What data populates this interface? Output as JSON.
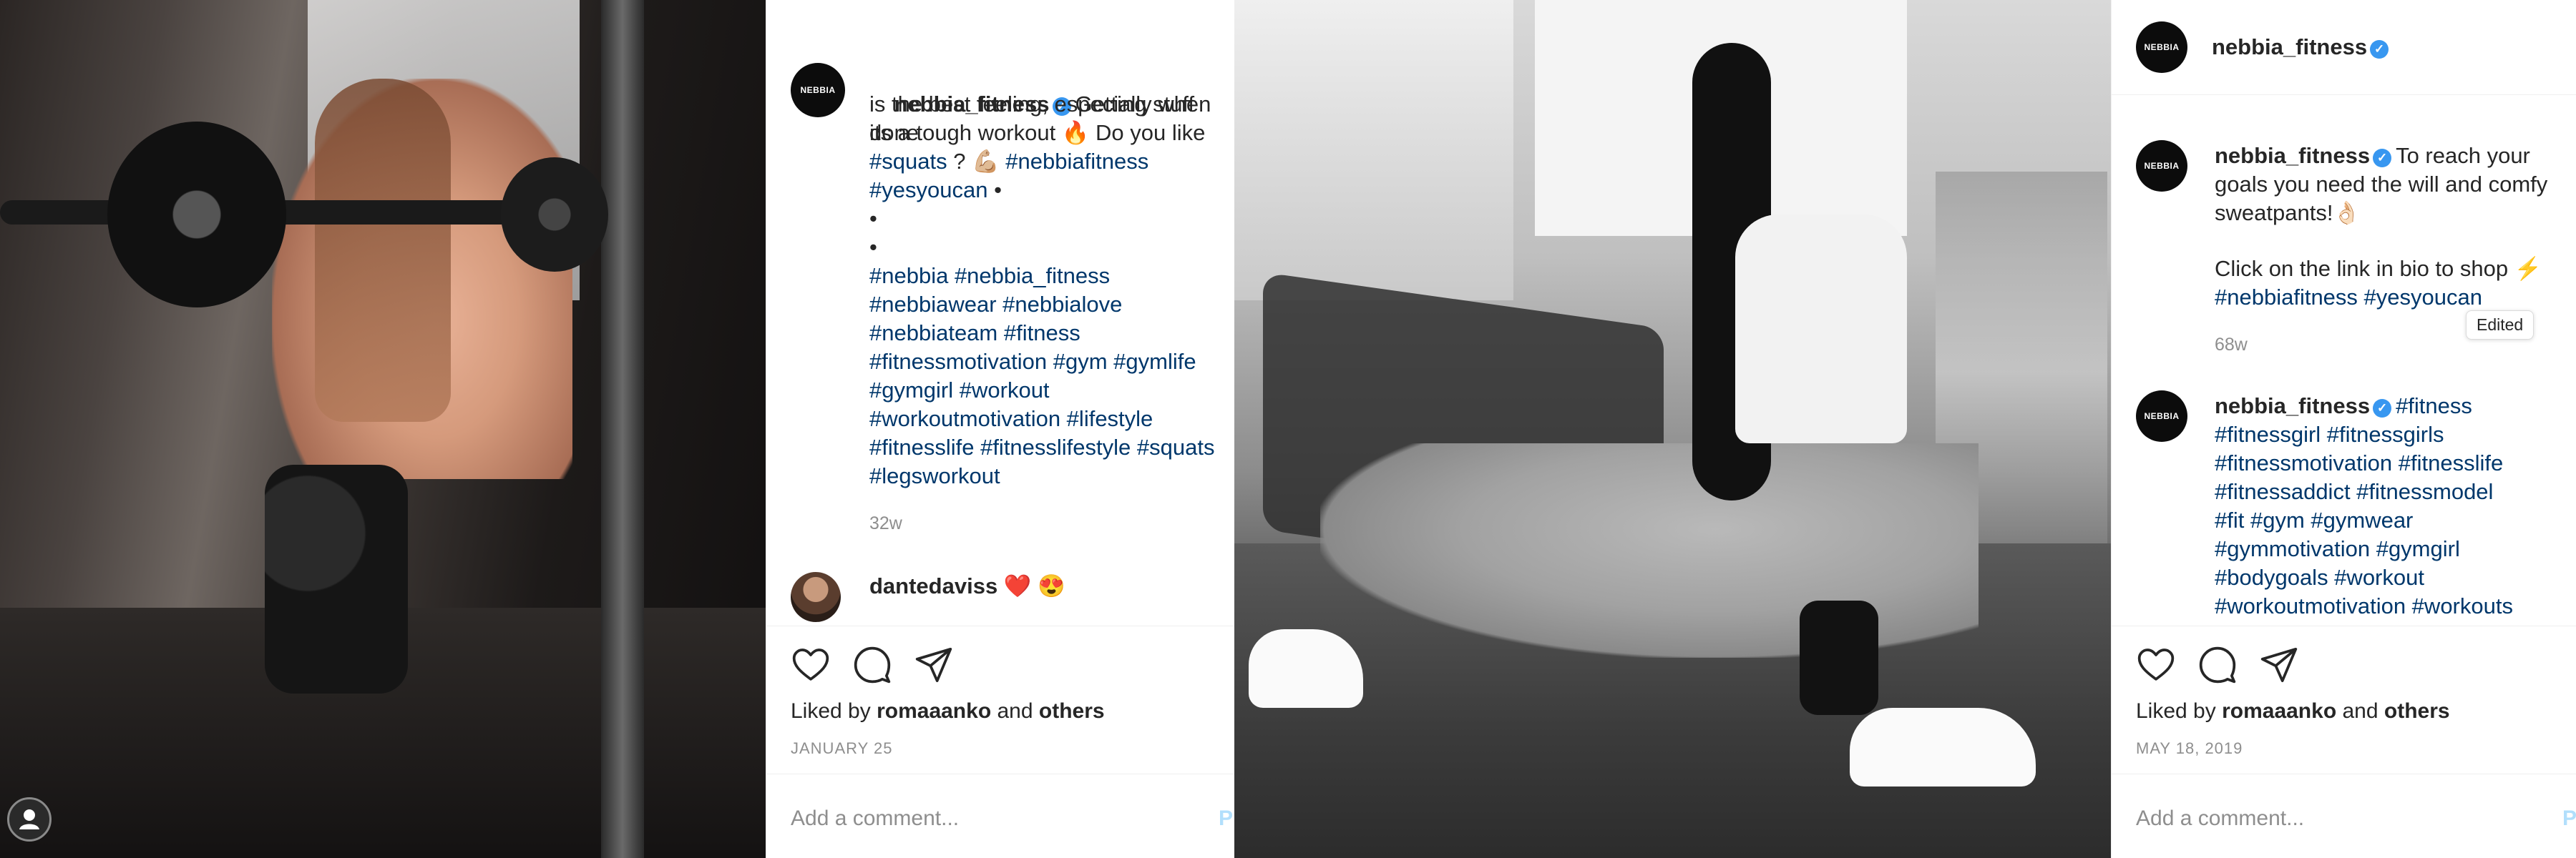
{
  "left_post": {
    "photo_icon": "person-icon",
    "caption": {
      "username": "nebbia_fitness",
      "verified_icon": "verified-badge-icon",
      "line1": "Getting stuff done",
      "line2": "is the best feeling, especially when",
      "line3a": "its a tough workout 🔥 Do you like",
      "line4_tag1": "#squats",
      "line4_text": " ? 💪🏼 ",
      "line4_tag2": "#nebbiafitness",
      "line5_tag": "#yesyoucan",
      "line5_text": " •",
      "bullet1": "•",
      "bullet2": "•",
      "hashtag_lines": [
        "#nebbia #nebbia_fitness",
        "#nebbiawear #nebbialove",
        "#nebbiateam #fitness",
        "#fitnessmotivation #gym #gymlife",
        "#gymgirl #workout",
        "#workoutmotivation #lifestyle",
        "#fitnesslife #fitnesslifestyle #squats",
        "#legsworkout"
      ],
      "time": "32w"
    },
    "comment": {
      "username": "dantedaviss",
      "text": " ❤️ 😍"
    },
    "actions": {
      "like_icon": "heart-icon",
      "comment_icon": "comment-icon",
      "share_icon": "paper-plane-icon"
    },
    "liked_by_prefix": "Liked by ",
    "liked_by_user": "romaaanko",
    "liked_by_mid": " and ",
    "liked_by_others": "others",
    "date": "JANUARY 25",
    "add_comment_placeholder": "Add a comment...",
    "post_label": "P"
  },
  "right_post": {
    "header_username": "nebbia_fitness",
    "caption": {
      "username": "nebbia_fitness",
      "line1": "To reach your",
      "line2": "goals you need the will and comfy",
      "line3": "sweatpants!👌🏻",
      "line4": "Click on the link in bio to shop ⚡",
      "tags": "#nebbiafitness #yesyoucan",
      "time": "68w",
      "edited_tooltip": "Edited"
    },
    "comment": {
      "username": "nebbia_fitness",
      "first_tag": "#fitness",
      "hashtag_lines": [
        "#fitnessgirl #fitnessgirls",
        "#fitnessmotivation #fitnesslife",
        "#fitnessaddict #fitnessmodel",
        "#fit #gym #gymwear",
        "#gymmotivation #gymgirl",
        "#bodygoals #workout",
        "#workoutmotivation #workouts"
      ]
    },
    "liked_by_prefix": "Liked by ",
    "liked_by_user": "romaaanko",
    "liked_by_mid": " and ",
    "liked_by_others": "others",
    "date": "MAY 18, 2019",
    "add_comment_placeholder": "Add a comment...",
    "post_label": "P"
  },
  "logo_text": "NEBBIA",
  "colors": {
    "hashtag": "#00376b",
    "verified": "#3897f0",
    "muted": "#8e8e8e",
    "post_button": "#b2dffc"
  }
}
